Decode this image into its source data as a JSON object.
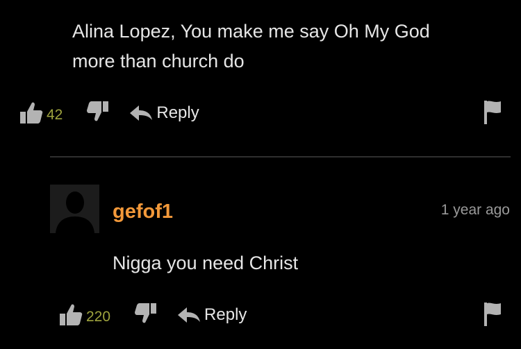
{
  "comment1": {
    "text_line1": "Alina Lopez, You make me say Oh My God",
    "text_line2": "more than church do",
    "like_count": "42",
    "reply_label": "Reply"
  },
  "comment2": {
    "username": "gefof1",
    "timestamp": "1 year ago",
    "text": "Nigga you need Christ",
    "like_count": "220",
    "reply_label": "Reply"
  },
  "icons": {
    "like": "thumbs-up-icon",
    "dislike": "thumbs-down-icon",
    "reply": "reply-arrow-icon",
    "flag": "flag-icon",
    "avatar": "default-user-avatar"
  },
  "colors": {
    "background": "#000000",
    "text": "#e6e6e6",
    "username": "#f3993a",
    "like_count": "#9ea33e",
    "icon": "#b3b3b3",
    "timestamp": "#9a9a9a"
  }
}
